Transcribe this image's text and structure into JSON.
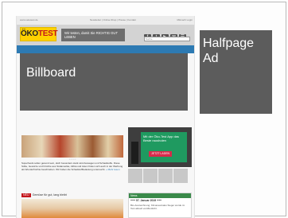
{
  "ads": {
    "billboard_label": "Billboard",
    "halfpage_label": "Halfpage Ad"
  },
  "site": {
    "url": "www.oekotest.de",
    "top_links": "Newsletter | Online-Shop | Presse | Kontakt",
    "login": "Mitmach Login",
    "logo_text": "ÖKO",
    "logo_text_red": "TEST",
    "tagline": "Wir testen, damit Sie RICHTIG GUT LEBEN",
    "social_icons": [
      "f",
      "t",
      "▶",
      "✉",
      "☰"
    ],
    "search_placeholder": "Suche",
    "nav": [
      "Startseite",
      "Kosmetik",
      "Gesundheit",
      "Essen",
      "Leben",
      "Bauen + Wohnen",
      "Geld",
      "Kinder + Familie",
      "Freizeit"
    ]
  },
  "content": {
    "slider_dots": "• • • • •",
    "teaser_text": "Superfoods sollen gesund sein, doch besonders stark sind Aussagen und Schadstoffe. Diese Süße, Gewürze und Früchte aus Südamerika, Afrika und Asien finden sich auch in der Werbung als Wunderfrüchte beschrieben. Wir haben die Schadstoffbelastung untersucht.",
    "teaser_more": "» Mehr lesen",
    "side_ad_text": "Mit der Öko-Test App das Beste rausholen",
    "side_ad_cta": "JETZT LADEN",
    "section_tag": "NEU",
    "section_title": "Gemüse für gut, lang bleibt",
    "news_heading": "News",
    "news_date": "+++ 07. Januar 2019 +++",
    "news_text": "Bio-Auszeichnung: Klimaneutrales Sieger wurde im Test aktuell veröffentlicht."
  }
}
